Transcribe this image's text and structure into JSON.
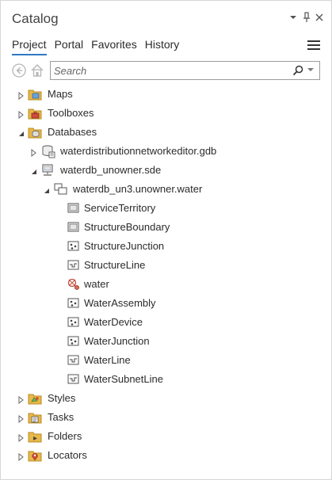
{
  "pane": {
    "title": "Catalog"
  },
  "tabs": [
    "Project",
    "Portal",
    "Favorites",
    "History"
  ],
  "search": {
    "placeholder": "Search"
  },
  "tree": {
    "maps": "Maps",
    "toolboxes": "Toolboxes",
    "databases": "Databases",
    "gdb": "waterdistributionnetworkeditor.gdb",
    "sde": "waterdb_unowner.sde",
    "dataset": "waterdb_un3.unowner.water",
    "items": [
      "ServiceTerritory",
      "StructureBoundary",
      "StructureJunction",
      "StructureLine",
      "water",
      "WaterAssembly",
      "WaterDevice",
      "WaterJunction",
      "WaterLine",
      "WaterSubnetLine"
    ],
    "styles": "Styles",
    "tasks": "Tasks",
    "folders": "Folders",
    "locators": "Locators"
  },
  "colors": {
    "accent": "#2e79c4",
    "folder": "#e8b84a",
    "utility_network": "#c44a3a"
  }
}
